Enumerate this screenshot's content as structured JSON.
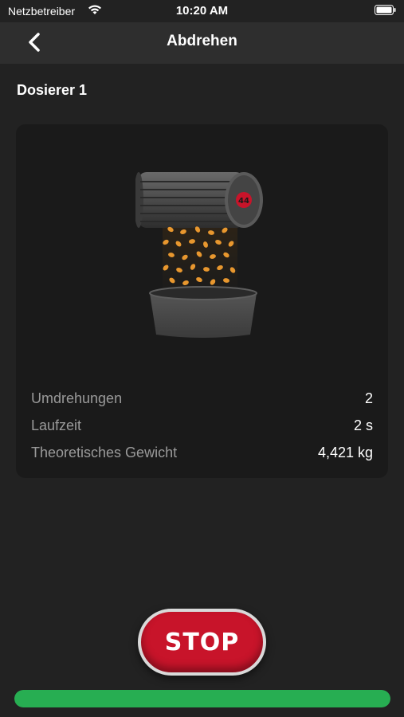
{
  "status_bar": {
    "carrier": "Netzbetreiber",
    "time": "10:20 AM"
  },
  "nav": {
    "title": "Abdrehen",
    "back_icon": "chevron-left-icon"
  },
  "section": {
    "title": "Dosierer 1"
  },
  "stats": [
    {
      "label": "Umdrehungen",
      "value": "2"
    },
    {
      "label": "Laufzeit",
      "value": "2 s"
    },
    {
      "label": "Theoretisches Gewicht",
      "value": "4,421 kg"
    }
  ],
  "stop_button": {
    "label": "STOP"
  },
  "progress": {
    "fraction": 1.0
  },
  "colors": {
    "background": "#222222",
    "accent": "#c8142a",
    "progress": "#27ae52"
  }
}
